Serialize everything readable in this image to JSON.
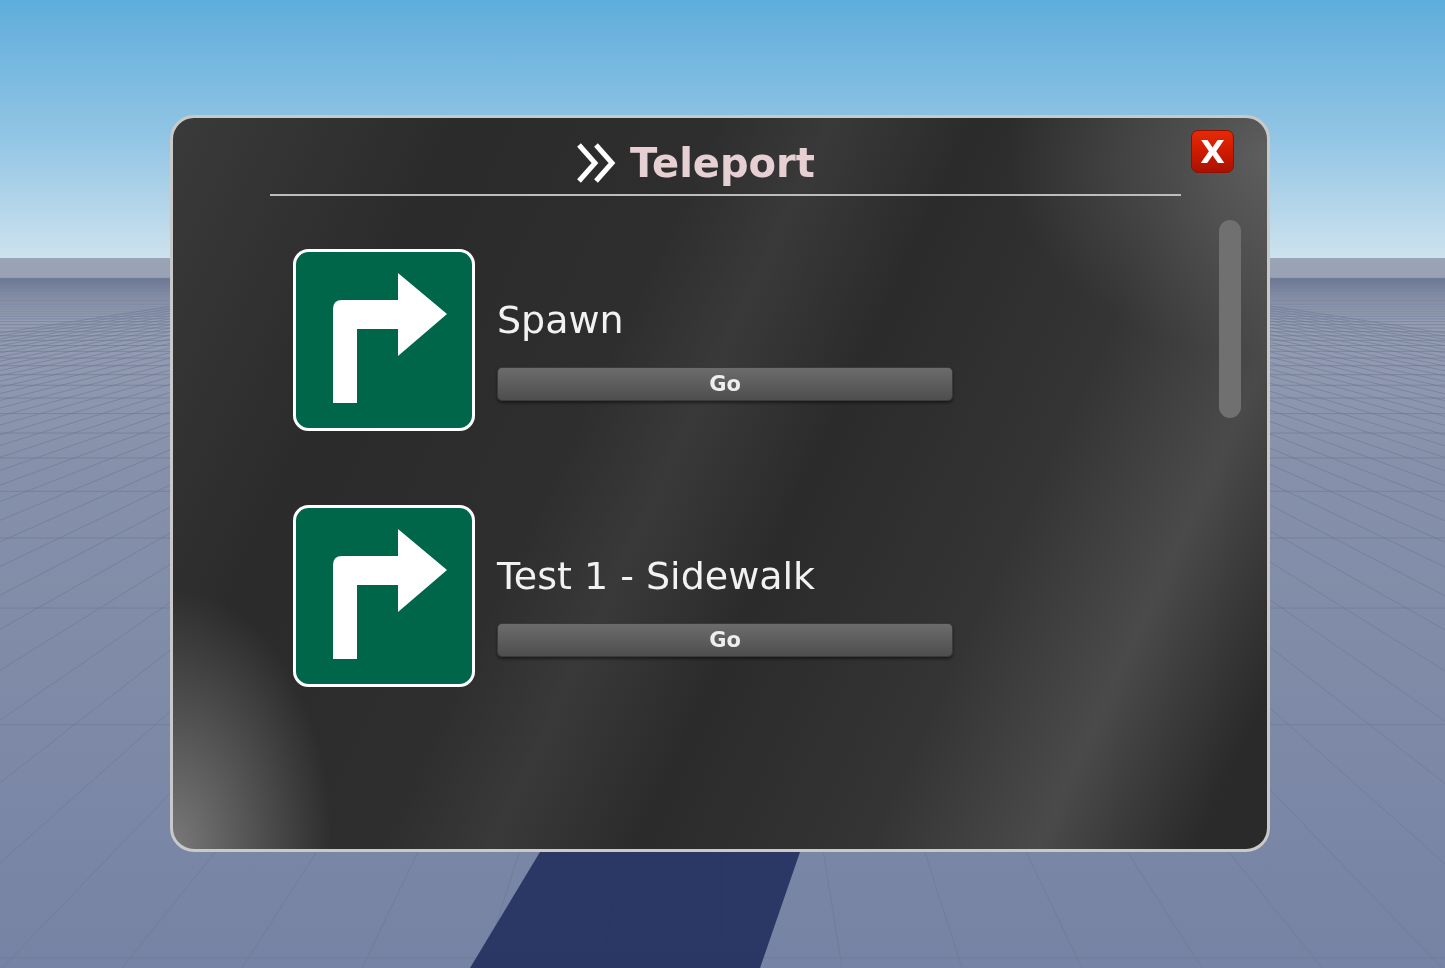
{
  "window": {
    "title": "Teleport"
  },
  "close_button": {
    "label": "X"
  },
  "locations": [
    {
      "name": "Spawn",
      "button": "Go"
    },
    {
      "name": "Test 1 - Sidewalk",
      "button": "Go"
    }
  ]
}
